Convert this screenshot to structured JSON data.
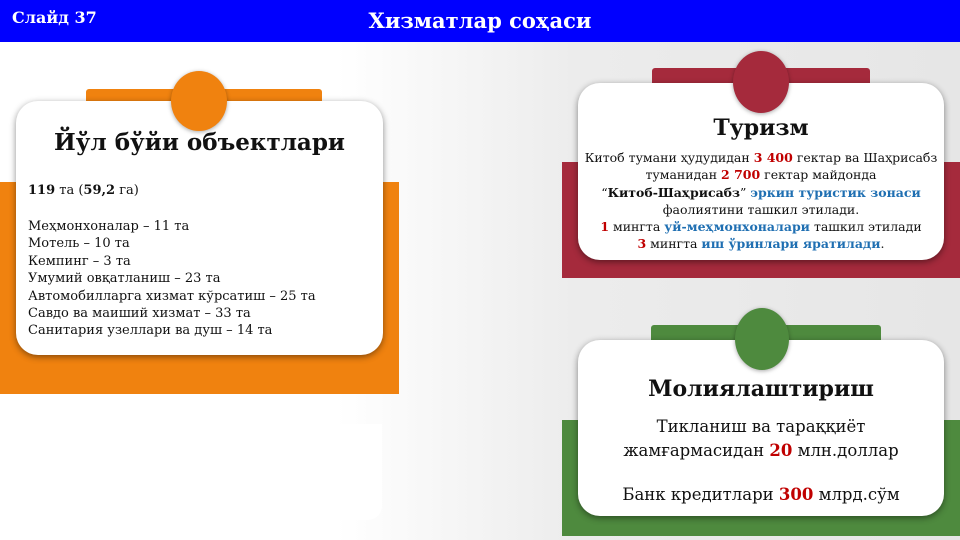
{
  "header": {
    "slide_label": "Слайд 37",
    "title": "Хизматлар соҳаси"
  },
  "road_objects": {
    "title": "Йўл бўйи объектлари",
    "total_count": "119",
    "total_unit": " та (",
    "total_area": "59,2",
    "total_area_unit": " га)",
    "items": [
      "Меҳмонхоналар – 11 та",
      "Мотель – 10 та",
      "Кемпинг – 3 та",
      "Умумий овқатланиш – 23 та",
      "Автомобилларга хизмат кўрсатиш – 25 та",
      "Савдо ва маиший хизмат – 33 та",
      "Санитария узеллари ва душ – 14 та"
    ]
  },
  "tourism": {
    "title": "Туризм",
    "p1_a": "Китоб тумани ҳудудидан ",
    "p1_num": "3 400",
    "p1_b": " гектар ва  Шаҳрисабз",
    "p2_a": "туманидан ",
    "p2_num": "2 700",
    "p2_b": " гектар майдонда",
    "p3_a": "“",
    "p3_name": "Китоб-Шаҳрисабз",
    "p3_b": "” ",
    "p3_zone": "эркин туристик зонаси",
    "p4": "фаолиятини  ташкил этилади.",
    "p5_num": "1",
    "p5_a": " мингта  ",
    "p5_hl": "уй-меҳмонхоналари",
    "p5_b": " ташкил этилади",
    "p6_num": "3",
    "p6_a": " мингта  ",
    "p6_hl": "иш ўринлари яратилади",
    "p6_b": "."
  },
  "finance": {
    "title": "Молиялаштириш",
    "line1": "Тикланиш ва тараққиёт",
    "line2_a": "жамғармасидан ",
    "line2_num": "20",
    "line2_b": " млн.доллар",
    "line3_a": "Банк кредитлари ",
    "line3_num": "300",
    "line3_b": " млрд.сўм"
  },
  "colors": {
    "header": "#0000ff",
    "orange": "#f0820f",
    "crimson": "#a52a3c",
    "green": "#4e8a3e",
    "red_text": "#c00000",
    "blue_text": "#1f6fb2"
  }
}
